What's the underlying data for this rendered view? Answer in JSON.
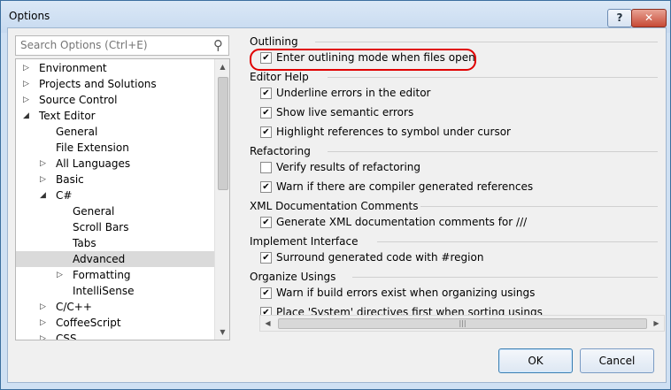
{
  "window": {
    "title": "Options",
    "help_label": "?",
    "close_label": "✕"
  },
  "search": {
    "placeholder": "Search Options (Ctrl+E)",
    "value": ""
  },
  "icons": {
    "search": "magnifier-icon",
    "expand": "triangle-right-icon",
    "collapse": "triangle-down-icon"
  },
  "tree": {
    "items": [
      {
        "label": "Environment",
        "state": "collapsed"
      },
      {
        "label": "Projects and Solutions",
        "state": "collapsed"
      },
      {
        "label": "Source Control",
        "state": "collapsed"
      },
      {
        "label": "Text Editor",
        "state": "expanded"
      },
      {
        "label": "General",
        "state": "leaf"
      },
      {
        "label": "File Extension",
        "state": "leaf"
      },
      {
        "label": "All Languages",
        "state": "collapsed"
      },
      {
        "label": "Basic",
        "state": "collapsed"
      },
      {
        "label": "C#",
        "state": "expanded"
      },
      {
        "label": "General",
        "state": "leaf"
      },
      {
        "label": "Scroll Bars",
        "state": "leaf"
      },
      {
        "label": "Tabs",
        "state": "leaf"
      },
      {
        "label": "Advanced",
        "state": "leaf",
        "selected": true
      },
      {
        "label": "Formatting",
        "state": "collapsed"
      },
      {
        "label": "IntelliSense",
        "state": "leaf"
      },
      {
        "label": "C/C++",
        "state": "collapsed"
      },
      {
        "label": "CoffeeScript",
        "state": "collapsed"
      },
      {
        "label": "CSS",
        "state": "collapsed"
      }
    ]
  },
  "sections": [
    {
      "title": "Outlining",
      "options": [
        {
          "label": "Enter outlining mode when files open",
          "checked": true
        }
      ]
    },
    {
      "title": "Editor Help",
      "options": [
        {
          "label": "Underline errors in the editor",
          "checked": true
        },
        {
          "label": "Show live semantic errors",
          "checked": true
        },
        {
          "label": "Highlight references to symbol under cursor",
          "checked": true
        }
      ]
    },
    {
      "title": "Refactoring",
      "options": [
        {
          "label": "Verify results of refactoring",
          "checked": false
        },
        {
          "label": "Warn if there are compiler generated references",
          "checked": true
        }
      ]
    },
    {
      "title": "XML Documentation Comments",
      "options": [
        {
          "label": "Generate XML documentation comments for ///",
          "checked": true
        }
      ]
    },
    {
      "title": "Implement Interface",
      "options": [
        {
          "label": "Surround generated code with #region",
          "checked": true
        }
      ]
    },
    {
      "title": "Organize Usings",
      "options": [
        {
          "label": "Warn if build errors exist when organizing usings",
          "checked": true
        },
        {
          "label": "Place 'System' directives first when sorting usings",
          "checked": true
        }
      ]
    }
  ],
  "buttons": {
    "ok": "OK",
    "cancel": "Cancel"
  },
  "colors": {
    "highlight_ring": "#e00000",
    "selected_item": "#dadada"
  }
}
